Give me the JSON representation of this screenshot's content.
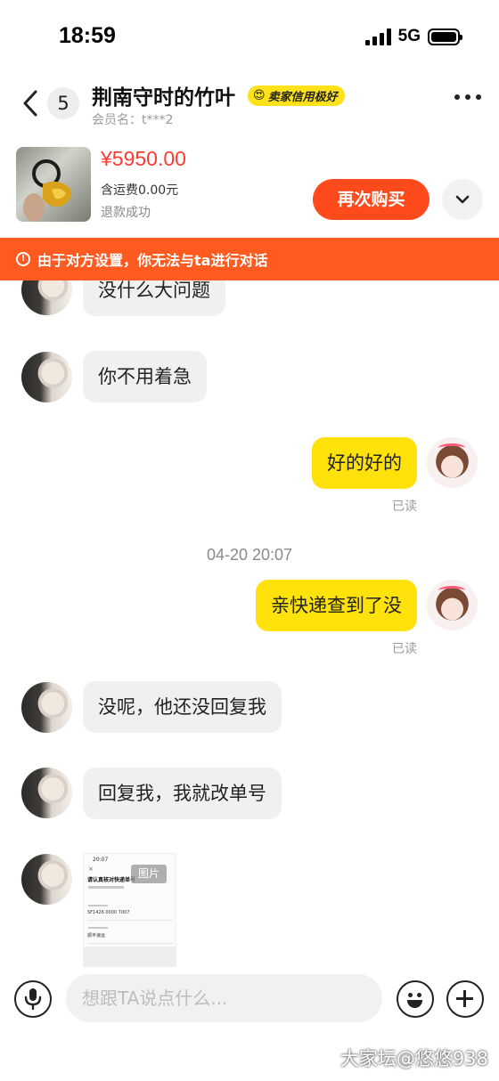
{
  "status_bar": {
    "time": "18:59",
    "network": "5G"
  },
  "header": {
    "unread_count": "5",
    "title": "荆南守时的竹叶",
    "seller_badge": "卖家信用极好",
    "member_line": "会员名：t***2"
  },
  "product": {
    "price": "¥5950.00",
    "shipping": "含运费0.00元",
    "status": "退款成功",
    "rebuy_label": "再次购买"
  },
  "warning": {
    "text": "由于对方设置，你无法与ta进行对话"
  },
  "messages": [
    {
      "side": "other",
      "text": "没什么大问题"
    },
    {
      "side": "other",
      "text": "你不用着急"
    },
    {
      "side": "self",
      "text": "好的好的",
      "read": "已读"
    },
    {
      "side": "self",
      "text": "亲快递查到了没",
      "read": "已读"
    },
    {
      "side": "other",
      "text": "没呢，他还没回复我"
    },
    {
      "side": "other",
      "text": "回复我，我就改单号"
    }
  ],
  "time_divider": "04-20 20:07",
  "image_message": {
    "tag": "图片",
    "preview_time": "20:07",
    "preview_title": "请认真核对快递单号",
    "preview_number": "SF1426 0000 7007",
    "preview_company": "顺丰速运"
  },
  "input": {
    "placeholder": "想跟TA说点什么..."
  },
  "watermark": "大家坛@悠悠938",
  "colors": {
    "accent": "#ff4a1b",
    "warning": "#ff5a20",
    "self_bubble": "#ffe20c",
    "price": "#ff3b30"
  }
}
